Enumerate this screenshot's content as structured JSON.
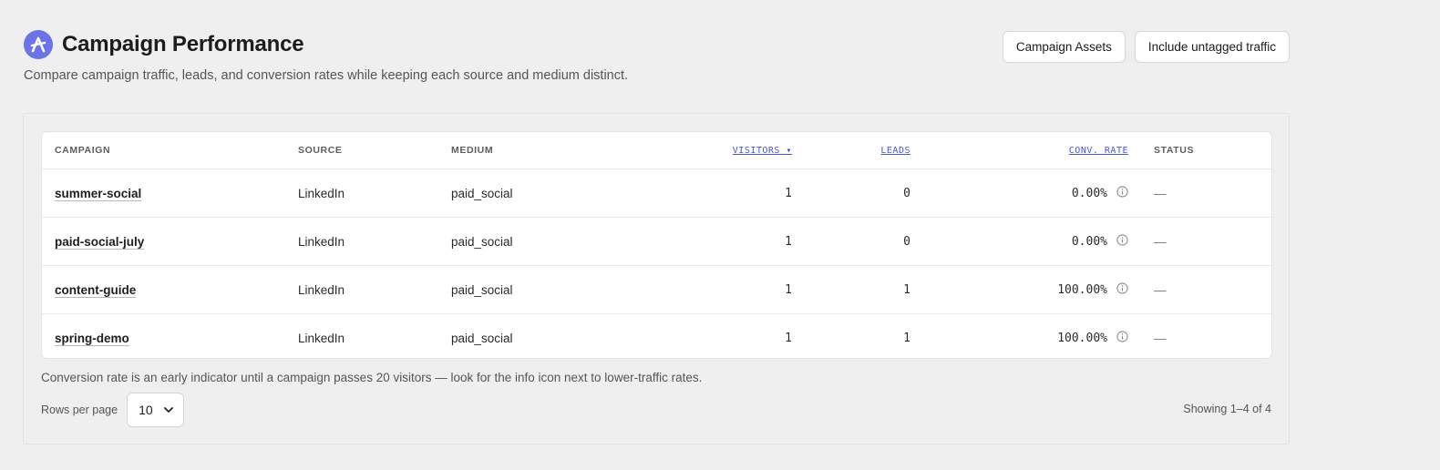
{
  "header": {
    "title": "Campaign Performance",
    "subtitle": "Compare campaign traffic, leads, and conversion rates while keeping each source and medium distinct.",
    "logo_icon": "brand-logo-icon",
    "accent_color": "#6b73e6"
  },
  "actions": {
    "campaign_assets": "Campaign Assets",
    "include_untagged": "Include untagged traffic"
  },
  "table": {
    "columns": {
      "campaign": "CAMPAIGN",
      "source": "SOURCE",
      "medium": "MEDIUM",
      "visitors": "VISITORS ▾",
      "leads": "LEADS",
      "conv_rate": "CONV. RATE",
      "status": "STATUS"
    },
    "rows": [
      {
        "campaign": "summer-social",
        "source": "LinkedIn",
        "medium": "paid_social",
        "visitors": "1",
        "leads": "0",
        "conv_rate": "0.00%",
        "status": "—"
      },
      {
        "campaign": "paid-social-july",
        "source": "LinkedIn",
        "medium": "paid_social",
        "visitors": "1",
        "leads": "0",
        "conv_rate": "0.00%",
        "status": "—"
      },
      {
        "campaign": "content-guide",
        "source": "LinkedIn",
        "medium": "paid_social",
        "visitors": "1",
        "leads": "1",
        "conv_rate": "100.00%",
        "status": "—"
      },
      {
        "campaign": "spring-demo",
        "source": "LinkedIn",
        "medium": "paid_social",
        "visitors": "1",
        "leads": "1",
        "conv_rate": "100.00%",
        "status": "—"
      }
    ]
  },
  "footer": {
    "note": "Conversion rate is an early indicator until a campaign passes 20 visitors — look for the info icon next to lower-traffic rates.",
    "rows_per_page_label": "Rows per page",
    "rows_per_page_value": "10",
    "showing": "Showing 1–4 of 4"
  }
}
